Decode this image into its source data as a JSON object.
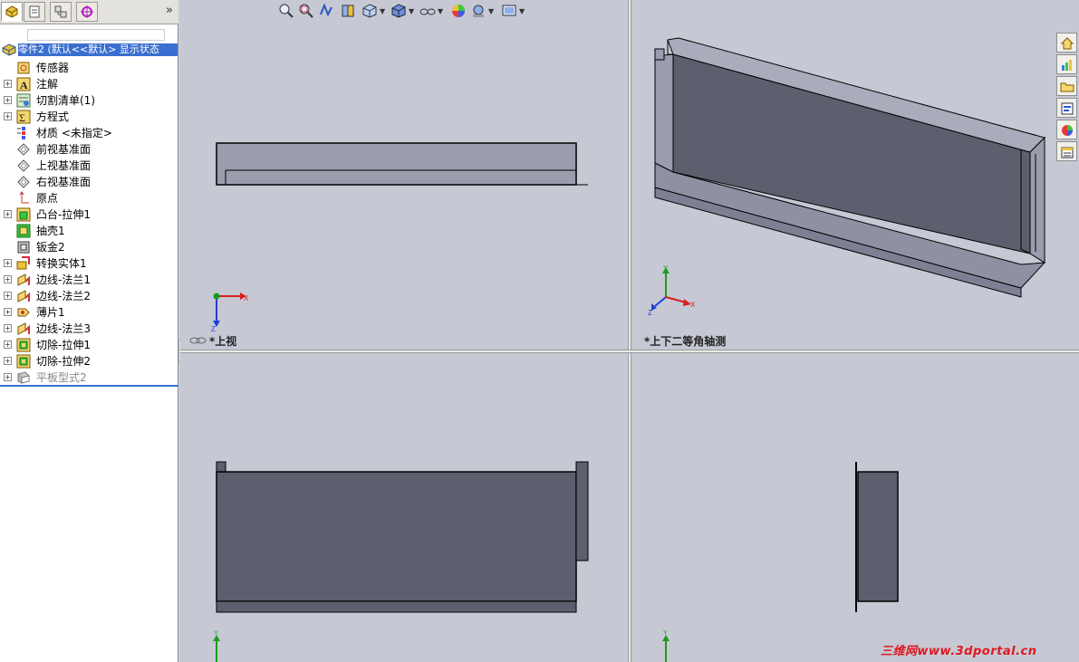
{
  "feature_manager": {
    "root_label": "零件2  (默认<<默认> 显示状态",
    "items": [
      {
        "label": "传感器",
        "expandable": false,
        "icon": "sensor-icon"
      },
      {
        "label": "注解",
        "expandable": true,
        "icon": "annotation-icon"
      },
      {
        "label": "切割清单(1)",
        "expandable": true,
        "icon": "cut-list-icon"
      },
      {
        "label": "方程式",
        "expandable": true,
        "icon": "equation-icon"
      },
      {
        "label": "材质 <未指定>",
        "expandable": false,
        "icon": "material-icon"
      },
      {
        "label": "前视基准面",
        "expandable": false,
        "icon": "plane-icon"
      },
      {
        "label": "上视基准面",
        "expandable": false,
        "icon": "plane-icon"
      },
      {
        "label": "右视基准面",
        "expandable": false,
        "icon": "plane-icon"
      },
      {
        "label": "原点",
        "expandable": false,
        "icon": "origin-icon"
      },
      {
        "label": "凸台-拉伸1",
        "expandable": true,
        "icon": "boss-extrude-icon"
      },
      {
        "label": "抽壳1",
        "expandable": false,
        "icon": "shell-icon"
      },
      {
        "label": "钣金2",
        "expandable": false,
        "icon": "sheet-metal-icon"
      },
      {
        "label": "转换实体1",
        "expandable": true,
        "icon": "convert-entities-icon"
      },
      {
        "label": "边线-法兰1",
        "expandable": true,
        "icon": "edge-flange-icon"
      },
      {
        "label": "边线-法兰2",
        "expandable": true,
        "icon": "edge-flange-icon"
      },
      {
        "label": "薄片1",
        "expandable": true,
        "icon": "base-flange-icon"
      },
      {
        "label": "边线-法兰3",
        "expandable": true,
        "icon": "edge-flange-icon"
      },
      {
        "label": "切除-拉伸1",
        "expandable": true,
        "icon": "cut-extrude-icon"
      },
      {
        "label": "切除-拉伸2",
        "expandable": true,
        "icon": "cut-extrude-icon"
      },
      {
        "label": "平板型式2",
        "expandable": true,
        "icon": "flat-pattern-icon",
        "suppressed": true
      }
    ],
    "more_glyph": "»"
  },
  "viewports": {
    "top_left_label": "*上视",
    "top_right_label": "*上下二等角轴测"
  },
  "triad": {
    "x": "X",
    "y": "Y",
    "z": "Z"
  },
  "watermark": "三维网www.3dportal.cn",
  "colors": {
    "background": "#c6c9d4",
    "part_face": "#5c5f6e",
    "part_light": "#8d91a2",
    "selection": "#3a6fcf",
    "triad_x": "#d81e1e",
    "triad_y": "#1e9a1e",
    "triad_z": "#1e3fd8"
  }
}
